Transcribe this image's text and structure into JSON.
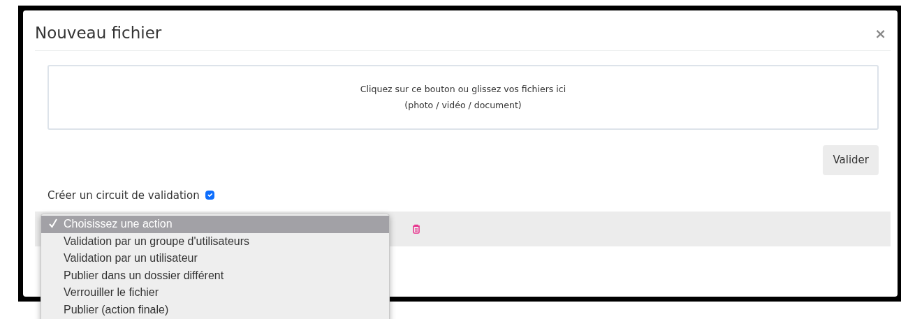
{
  "modal": {
    "title": "Nouveau fichier",
    "close": "×"
  },
  "dropzone": {
    "lines": [
      "Cliquez sur ce bouton ou glissez vos fichiers ici",
      "(photo / vidéo / document)"
    ]
  },
  "submit_button": "Valider",
  "validation_circuit": {
    "label": "Créer un circuit de validation",
    "checked": true
  },
  "action_dropdown": {
    "open": true,
    "options": [
      {
        "label": "Choisissez une action",
        "selected": true
      },
      {
        "label": "Validation par un groupe d'utilisateurs",
        "selected": false
      },
      {
        "label": "Validation par un utilisateur",
        "selected": false
      },
      {
        "label": "Publier dans un dossier différent",
        "selected": false
      },
      {
        "label": "Verrouiller le fichier",
        "selected": false
      },
      {
        "label": "Publier (action finale)",
        "selected": false
      }
    ]
  }
}
